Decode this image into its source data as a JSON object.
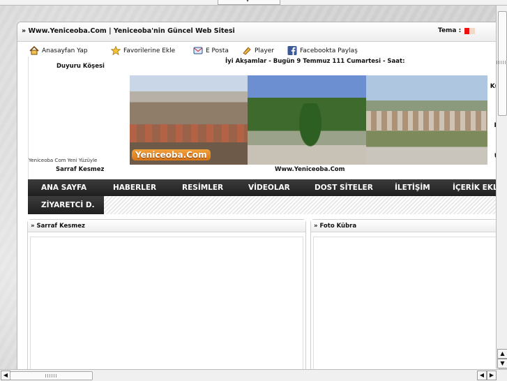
{
  "header": {
    "site_title": "» Www.Yeniceoba.Com | Yeniceoba'nin Güncel Web Sitesi",
    "tema_label": "Tema :",
    "swatches": [
      "#e11111",
      "#f3d9c8"
    ]
  },
  "links": [
    {
      "label": "Anasayfan Yap",
      "icon": "home-icon"
    },
    {
      "label": "Favorilerine Ekle",
      "icon": "star-icon"
    },
    {
      "label": "E Posta",
      "icon": "mail-icon"
    },
    {
      "label": "Player",
      "icon": "music-icon"
    },
    {
      "label": "Facebookta Paylaş",
      "icon": "facebook-icon"
    }
  ],
  "info": {
    "duyuru": "Duyuru Köşesi",
    "greeting": "İyi Akşamlar - Bugün 9 Temmuz 111 Cumartesi - Saat:",
    "blurb": "Yeniceoba Com Yeni Yüzüyle",
    "right_letters": [
      "Ku",
      "H",
      "Ü"
    ]
  },
  "banner": {
    "logo_text": "Yeniceoba.Com"
  },
  "marquee": {
    "left": "Sarraf Kesmez",
    "right": "Www.Yeniceoba.Com"
  },
  "nav": {
    "items": [
      "ANA SAYFA",
      "HABERLER",
      "RESİMLER",
      "VİDEOLAR",
      "DOST SİTELER",
      "İLETİŞİM",
      "İÇERİK EKLE"
    ],
    "row2": [
      "ZİYARETCİ D."
    ]
  },
  "boxes": {
    "left_title": "» Sarraf Kesmez",
    "right_title": "» Foto Kübra"
  },
  "scrollbars": {
    "up": "▲",
    "down": "▼",
    "down2": "▼",
    "left": "◀",
    "right": "▶",
    "left2": "◀"
  },
  "browser": {
    "tab_arrow": "▾"
  }
}
